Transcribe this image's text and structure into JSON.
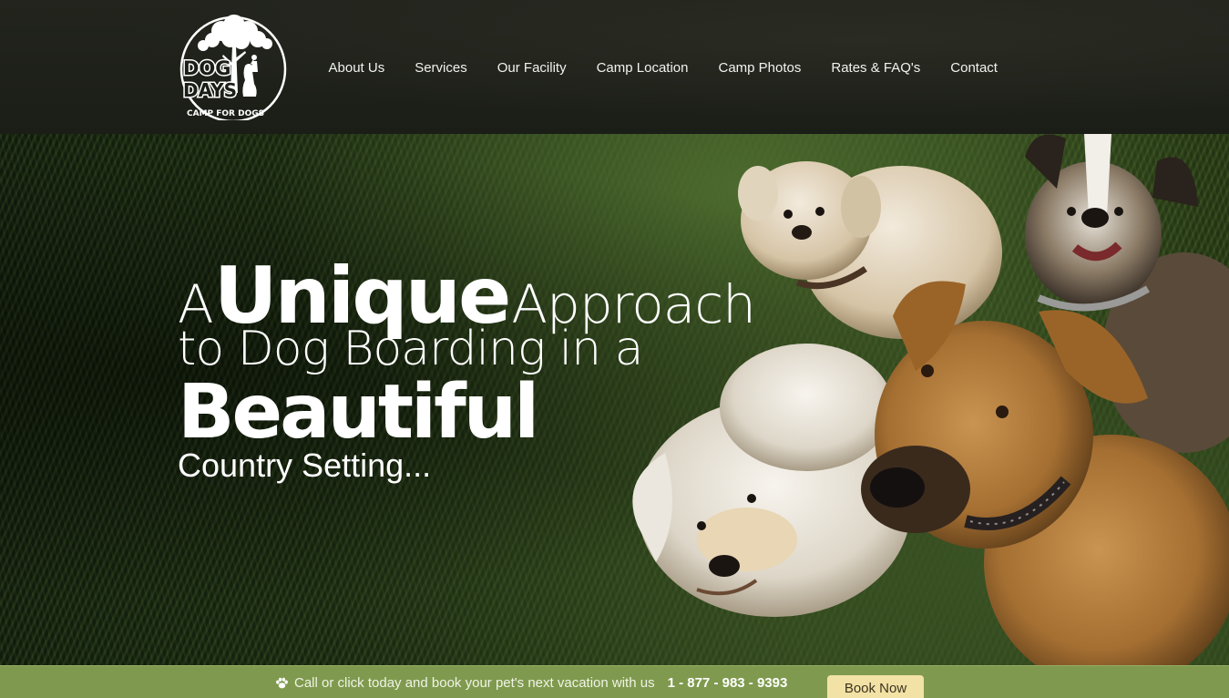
{
  "logo": {
    "alt": "Dog Days Camp for Dogs",
    "line1": "DOG",
    "line2": "DAYS",
    "tagline": "CAMP FOR DOGS"
  },
  "nav": {
    "items": [
      {
        "label": "About Us"
      },
      {
        "label": "Services"
      },
      {
        "label": "Our Facility"
      },
      {
        "label": "Camp Location"
      },
      {
        "label": "Camp Photos"
      },
      {
        "label": "Rates & FAQ's"
      },
      {
        "label": "Contact"
      }
    ]
  },
  "hero": {
    "line1_a": "A",
    "line1_unique": "Unique",
    "line1_approach": "Approach",
    "line2": "to Dog Boarding in a",
    "line3": "Beautiful",
    "line4": "Country Setting..."
  },
  "cta": {
    "icon": "paw-icon",
    "text": "Call or click today and book your pet's next vacation with us",
    "phone": "1 - 877 - 983 - 9393",
    "button_label": "Book Now"
  },
  "colors": {
    "header_bg": "#1f211a",
    "cta_bar": "#7f9a4e",
    "button_bg": "#f3e2a5",
    "text": "#ffffff"
  }
}
